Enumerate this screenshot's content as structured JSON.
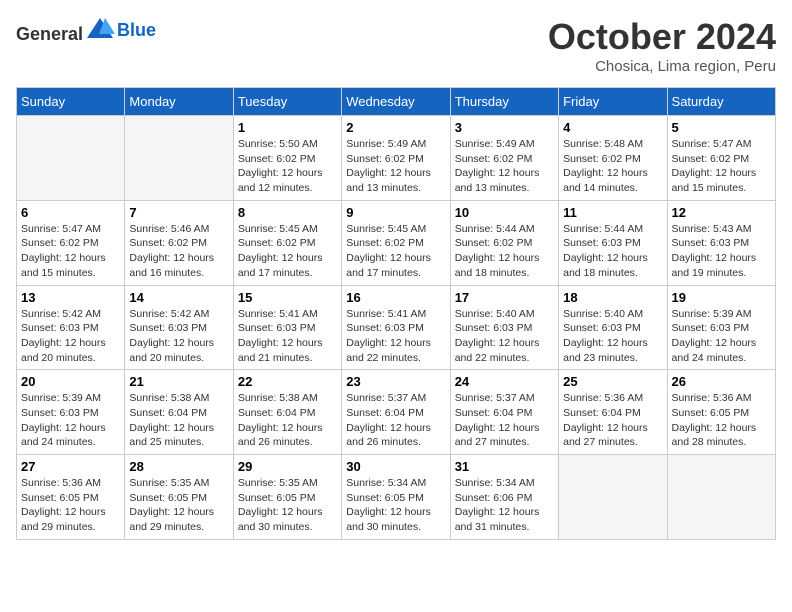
{
  "header": {
    "logo_general": "General",
    "logo_blue": "Blue",
    "month_title": "October 2024",
    "subtitle": "Chosica, Lima region, Peru"
  },
  "days_of_week": [
    "Sunday",
    "Monday",
    "Tuesday",
    "Wednesday",
    "Thursday",
    "Friday",
    "Saturday"
  ],
  "weeks": [
    [
      {
        "day": "",
        "empty": true
      },
      {
        "day": "",
        "empty": true
      },
      {
        "day": "1",
        "sunrise": "Sunrise: 5:50 AM",
        "sunset": "Sunset: 6:02 PM",
        "daylight": "Daylight: 12 hours and 12 minutes."
      },
      {
        "day": "2",
        "sunrise": "Sunrise: 5:49 AM",
        "sunset": "Sunset: 6:02 PM",
        "daylight": "Daylight: 12 hours and 13 minutes."
      },
      {
        "day": "3",
        "sunrise": "Sunrise: 5:49 AM",
        "sunset": "Sunset: 6:02 PM",
        "daylight": "Daylight: 12 hours and 13 minutes."
      },
      {
        "day": "4",
        "sunrise": "Sunrise: 5:48 AM",
        "sunset": "Sunset: 6:02 PM",
        "daylight": "Daylight: 12 hours and 14 minutes."
      },
      {
        "day": "5",
        "sunrise": "Sunrise: 5:47 AM",
        "sunset": "Sunset: 6:02 PM",
        "daylight": "Daylight: 12 hours and 15 minutes."
      }
    ],
    [
      {
        "day": "6",
        "sunrise": "Sunrise: 5:47 AM",
        "sunset": "Sunset: 6:02 PM",
        "daylight": "Daylight: 12 hours and 15 minutes."
      },
      {
        "day": "7",
        "sunrise": "Sunrise: 5:46 AM",
        "sunset": "Sunset: 6:02 PM",
        "daylight": "Daylight: 12 hours and 16 minutes."
      },
      {
        "day": "8",
        "sunrise": "Sunrise: 5:45 AM",
        "sunset": "Sunset: 6:02 PM",
        "daylight": "Daylight: 12 hours and 17 minutes."
      },
      {
        "day": "9",
        "sunrise": "Sunrise: 5:45 AM",
        "sunset": "Sunset: 6:02 PM",
        "daylight": "Daylight: 12 hours and 17 minutes."
      },
      {
        "day": "10",
        "sunrise": "Sunrise: 5:44 AM",
        "sunset": "Sunset: 6:02 PM",
        "daylight": "Daylight: 12 hours and 18 minutes."
      },
      {
        "day": "11",
        "sunrise": "Sunrise: 5:44 AM",
        "sunset": "Sunset: 6:03 PM",
        "daylight": "Daylight: 12 hours and 18 minutes."
      },
      {
        "day": "12",
        "sunrise": "Sunrise: 5:43 AM",
        "sunset": "Sunset: 6:03 PM",
        "daylight": "Daylight: 12 hours and 19 minutes."
      }
    ],
    [
      {
        "day": "13",
        "sunrise": "Sunrise: 5:42 AM",
        "sunset": "Sunset: 6:03 PM",
        "daylight": "Daylight: 12 hours and 20 minutes."
      },
      {
        "day": "14",
        "sunrise": "Sunrise: 5:42 AM",
        "sunset": "Sunset: 6:03 PM",
        "daylight": "Daylight: 12 hours and 20 minutes."
      },
      {
        "day": "15",
        "sunrise": "Sunrise: 5:41 AM",
        "sunset": "Sunset: 6:03 PM",
        "daylight": "Daylight: 12 hours and 21 minutes."
      },
      {
        "day": "16",
        "sunrise": "Sunrise: 5:41 AM",
        "sunset": "Sunset: 6:03 PM",
        "daylight": "Daylight: 12 hours and 22 minutes."
      },
      {
        "day": "17",
        "sunrise": "Sunrise: 5:40 AM",
        "sunset": "Sunset: 6:03 PM",
        "daylight": "Daylight: 12 hours and 22 minutes."
      },
      {
        "day": "18",
        "sunrise": "Sunrise: 5:40 AM",
        "sunset": "Sunset: 6:03 PM",
        "daylight": "Daylight: 12 hours and 23 minutes."
      },
      {
        "day": "19",
        "sunrise": "Sunrise: 5:39 AM",
        "sunset": "Sunset: 6:03 PM",
        "daylight": "Daylight: 12 hours and 24 minutes."
      }
    ],
    [
      {
        "day": "20",
        "sunrise": "Sunrise: 5:39 AM",
        "sunset": "Sunset: 6:03 PM",
        "daylight": "Daylight: 12 hours and 24 minutes."
      },
      {
        "day": "21",
        "sunrise": "Sunrise: 5:38 AM",
        "sunset": "Sunset: 6:04 PM",
        "daylight": "Daylight: 12 hours and 25 minutes."
      },
      {
        "day": "22",
        "sunrise": "Sunrise: 5:38 AM",
        "sunset": "Sunset: 6:04 PM",
        "daylight": "Daylight: 12 hours and 26 minutes."
      },
      {
        "day": "23",
        "sunrise": "Sunrise: 5:37 AM",
        "sunset": "Sunset: 6:04 PM",
        "daylight": "Daylight: 12 hours and 26 minutes."
      },
      {
        "day": "24",
        "sunrise": "Sunrise: 5:37 AM",
        "sunset": "Sunset: 6:04 PM",
        "daylight": "Daylight: 12 hours and 27 minutes."
      },
      {
        "day": "25",
        "sunrise": "Sunrise: 5:36 AM",
        "sunset": "Sunset: 6:04 PM",
        "daylight": "Daylight: 12 hours and 27 minutes."
      },
      {
        "day": "26",
        "sunrise": "Sunrise: 5:36 AM",
        "sunset": "Sunset: 6:05 PM",
        "daylight": "Daylight: 12 hours and 28 minutes."
      }
    ],
    [
      {
        "day": "27",
        "sunrise": "Sunrise: 5:36 AM",
        "sunset": "Sunset: 6:05 PM",
        "daylight": "Daylight: 12 hours and 29 minutes."
      },
      {
        "day": "28",
        "sunrise": "Sunrise: 5:35 AM",
        "sunset": "Sunset: 6:05 PM",
        "daylight": "Daylight: 12 hours and 29 minutes."
      },
      {
        "day": "29",
        "sunrise": "Sunrise: 5:35 AM",
        "sunset": "Sunset: 6:05 PM",
        "daylight": "Daylight: 12 hours and 30 minutes."
      },
      {
        "day": "30",
        "sunrise": "Sunrise: 5:34 AM",
        "sunset": "Sunset: 6:05 PM",
        "daylight": "Daylight: 12 hours and 30 minutes."
      },
      {
        "day": "31",
        "sunrise": "Sunrise: 5:34 AM",
        "sunset": "Sunset: 6:06 PM",
        "daylight": "Daylight: 12 hours and 31 minutes."
      },
      {
        "day": "",
        "empty": true
      },
      {
        "day": "",
        "empty": true
      }
    ]
  ]
}
